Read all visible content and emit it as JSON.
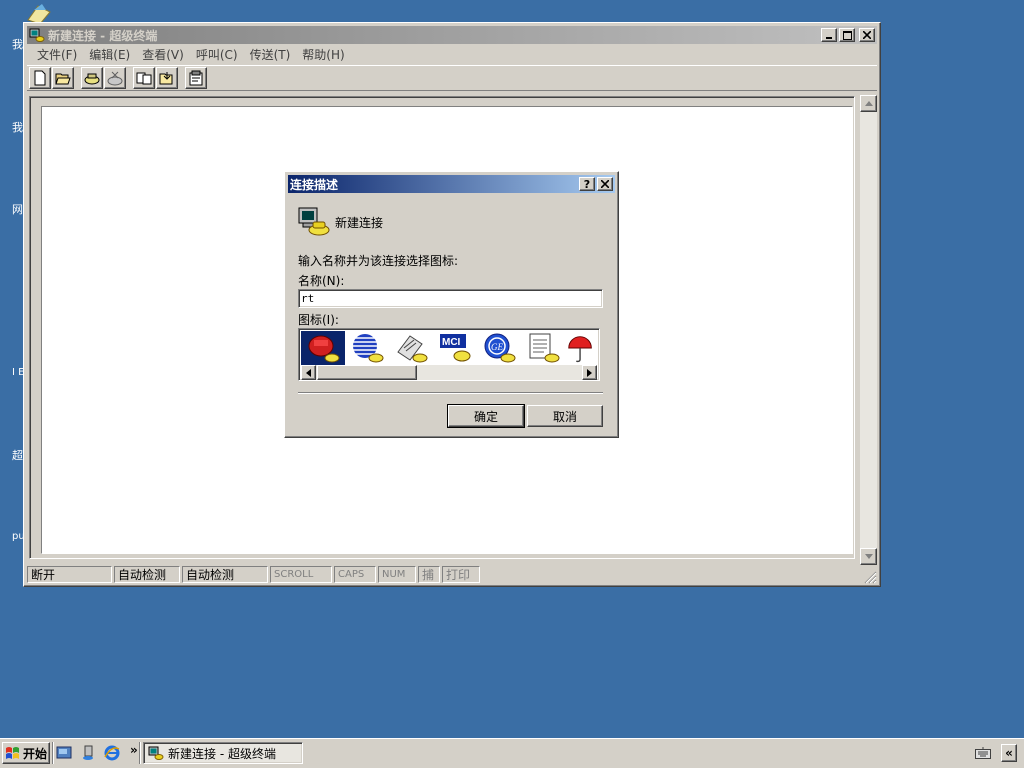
{
  "desktop": {
    "icon_labels": [
      "我",
      "我",
      "网",
      "I E",
      "超",
      "pu"
    ]
  },
  "main_window": {
    "title": "新建连接 - 超级终端",
    "menu": [
      "文件(F)",
      "编辑(E)",
      "查看(V)",
      "呼叫(C)",
      "传送(T)",
      "帮助(H)"
    ],
    "toolbar": [
      "new-icon",
      "open-icon",
      "call-icon",
      "disconnect-icon",
      "send-icon",
      "receive-icon",
      "properties-icon"
    ],
    "status": {
      "connection": "断开",
      "detect1": "自动检测",
      "detect2": "自动检测",
      "scroll": "SCROLL",
      "caps": "CAPS",
      "num": "NUM",
      "capture": "捕",
      "print": "打印"
    }
  },
  "dialog": {
    "title": "连接描述",
    "header": "新建连接",
    "instruction": "输入名称并为该连接选择图标:",
    "name_label": "名称(N):",
    "name_value": "rt",
    "icon_label": "图标(I):",
    "icons": [
      "phone-icon",
      "globe-icon",
      "fax-icon",
      "mci-icon",
      "ge-icon",
      "notes-icon",
      "umbrella-icon"
    ],
    "selected_icon": 0,
    "ok": "确定",
    "cancel": "取消"
  },
  "taskbar": {
    "start": "开始",
    "task_title": "新建连接 - 超级终端",
    "chevron": "»",
    "tray_chevron": "«"
  }
}
